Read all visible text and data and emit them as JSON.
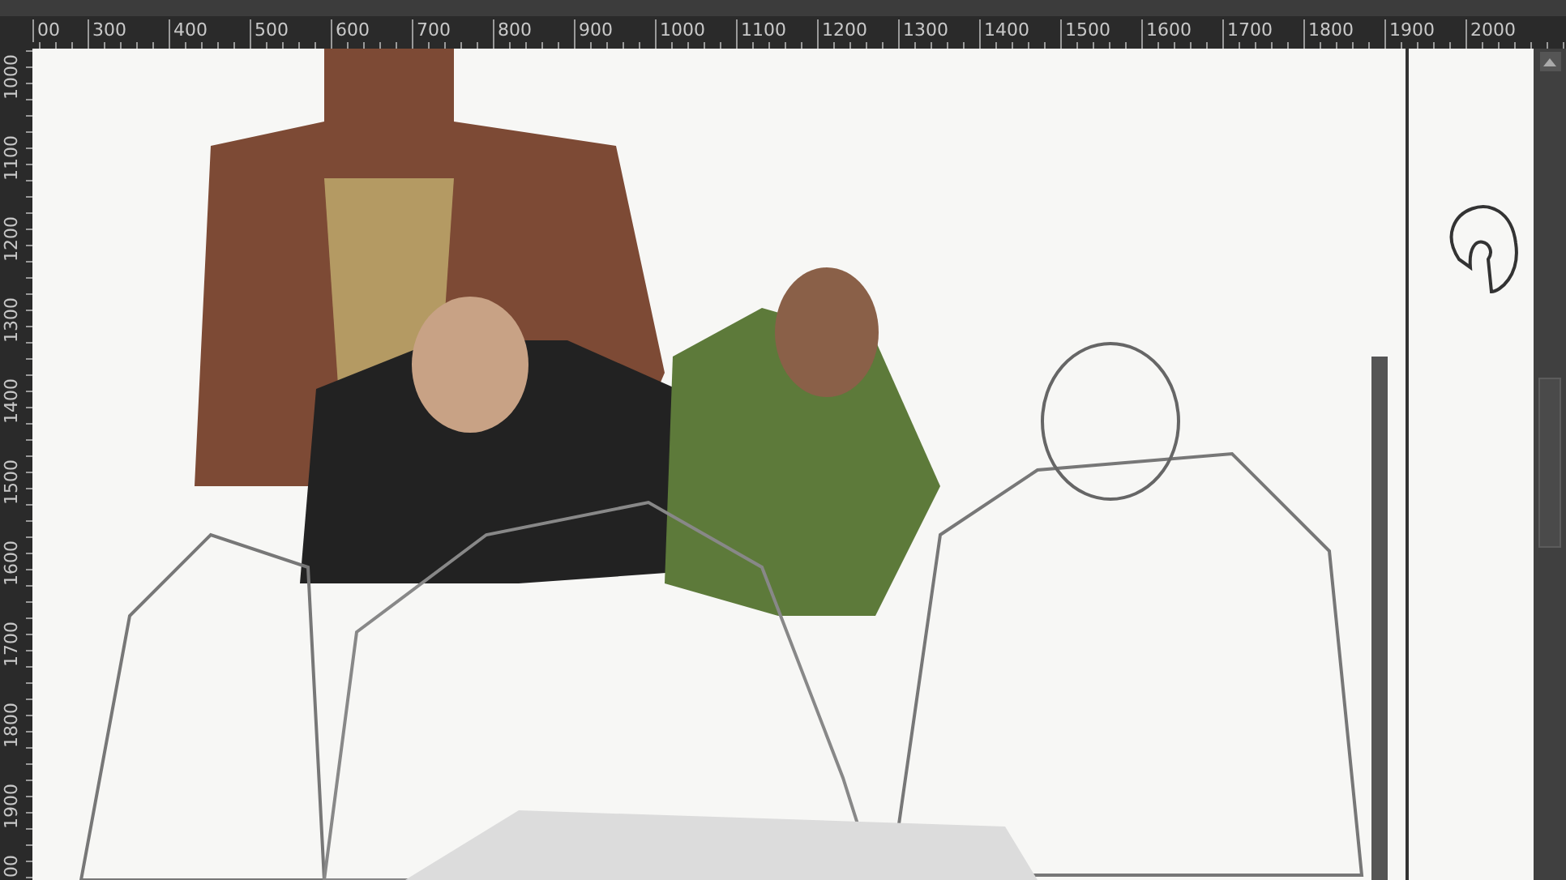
{
  "top_ruler": {
    "labels": [
      "00",
      "300",
      "400",
      "500",
      "600",
      "700",
      "800",
      "900",
      "1000",
      "1100",
      "1200",
      "1300",
      "1400",
      "1500",
      "1600",
      "1700",
      "1800",
      "1900",
      "2000"
    ]
  },
  "left_ruler": {
    "labels": [
      "1000",
      "1100",
      "1200",
      "1300",
      "1400",
      "1500",
      "1600",
      "1700",
      "1800",
      "1900",
      "00"
    ]
  }
}
